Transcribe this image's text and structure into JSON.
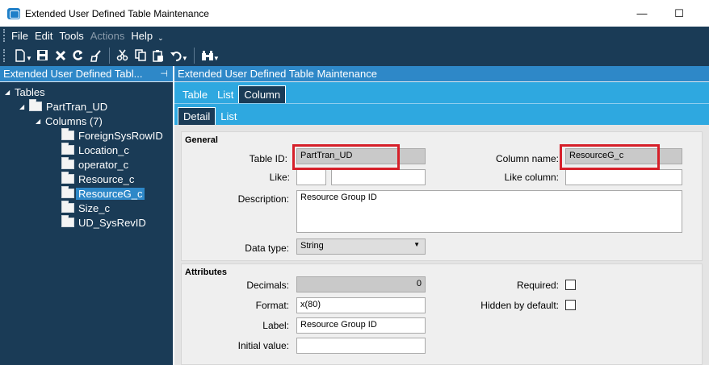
{
  "window": {
    "title": "Extended User Defined Table Maintenance",
    "minimize_glyph": "—",
    "maximize_glyph": "☐"
  },
  "menu": {
    "items": [
      "File",
      "Edit",
      "Tools",
      "Actions",
      "Help"
    ],
    "more": "⌄"
  },
  "toolbar": {
    "icons": [
      "new-icon",
      "save-icon",
      "delete-icon",
      "refresh-icon",
      "clear-icon",
      "cut-icon",
      "copy-icon",
      "paste-icon",
      "undo-icon",
      "search-icon"
    ]
  },
  "left_panel": {
    "title": "Extended User Defined Tabl...",
    "pin": "⊣",
    "tree": {
      "root": "Tables",
      "table": "PartTran_UD",
      "columns_node": "Columns (7)",
      "columns": [
        "ForeignSysRowID",
        "Location_c",
        "operator_c",
        "Resource_c",
        "ResourceG_c",
        "Size_c",
        "UD_SysRevID"
      ],
      "selected": "ResourceG_c"
    }
  },
  "right_panel": {
    "title": "Extended User Defined Table Maintenance",
    "tabs": [
      "Table",
      "List",
      "Column"
    ],
    "active_tab": "Column",
    "subtabs": [
      "Detail",
      "List"
    ],
    "active_subtab": "Detail"
  },
  "general": {
    "section_title": "General",
    "table_id_label": "Table ID:",
    "table_id_value": "PartTran_UD",
    "column_name_label": "Column name:",
    "column_name_value": "ResourceG_c",
    "like_label": "Like:",
    "like_value1": "",
    "like_value2": "",
    "like_column_label": "Like column:",
    "like_column_value": "",
    "description_label": "Description:",
    "description_value": "Resource Group ID",
    "data_type_label": "Data type:",
    "data_type_value": "String"
  },
  "attributes": {
    "section_title": "Attributes",
    "decimals_label": "Decimals:",
    "decimals_value": "0",
    "format_label": "Format:",
    "format_value": "x(80)",
    "label_label": "Label:",
    "label_value": "Resource Group ID",
    "initial_value_label": "Initial value:",
    "initial_value": "",
    "required_label": "Required:",
    "hidden_label": "Hidden by default:"
  },
  "colors": {
    "dark_navy": "#1a3b56",
    "header_blue": "#2e88c8",
    "tab_blue": "#2ea8e0",
    "highlight_red": "#d6202a"
  }
}
